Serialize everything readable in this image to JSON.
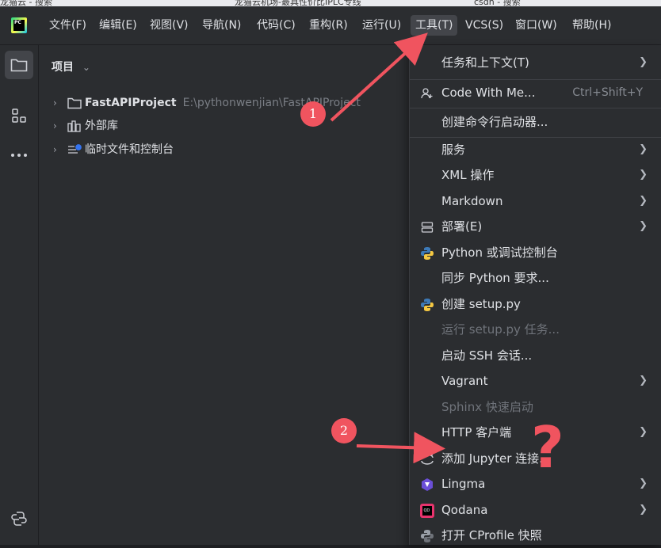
{
  "browser_tabs": [
    "龙猫云 - 搜索",
    "龙猫云机场-最具性价比IPLC专线",
    "csdn - 搜索"
  ],
  "menubar": {
    "items": [
      {
        "label": "文件(F)"
      },
      {
        "label": "编辑(E)"
      },
      {
        "label": "视图(V)"
      },
      {
        "label": "导航(N)"
      },
      {
        "label": "代码(C)"
      },
      {
        "label": "重构(R)"
      },
      {
        "label": "运行(U)"
      },
      {
        "label": "工具(T)",
        "active": true
      },
      {
        "label": "VCS(S)"
      },
      {
        "label": "窗口(W)"
      },
      {
        "label": "帮助(H)"
      }
    ]
  },
  "panel": {
    "title": "项目",
    "tree": [
      {
        "label": "FastAPIProject",
        "path": "E:\\pythonwenjian\\FastAPIProject",
        "icon": "folder-icon"
      },
      {
        "label": "外部库",
        "icon": "library-icon"
      },
      {
        "label": "临时文件和控制台",
        "icon": "scratches-icon"
      }
    ]
  },
  "tools_menu": {
    "items": [
      {
        "label": "任务和上下文(T)",
        "submenu": true
      },
      {
        "label": "Code With Me...",
        "shortcut": "Ctrl+Shift+Y",
        "icon": "person-add-icon"
      },
      {
        "label": "创建命令行启动器..."
      },
      {
        "label": "服务",
        "submenu": true
      },
      {
        "label": "XML 操作",
        "submenu": true
      },
      {
        "label": "Markdown",
        "submenu": true
      },
      {
        "label": "部署(E)",
        "submenu": true,
        "icon": "server-icon"
      },
      {
        "label": "Python 或调试控制台",
        "icon": "python-icon"
      },
      {
        "label": "同步 Python 要求..."
      },
      {
        "label": "创建 setup.py",
        "icon": "python-icon"
      },
      {
        "label": "运行 setup.py 任务...",
        "disabled": true
      },
      {
        "label": "启动 SSH 会话..."
      },
      {
        "label": "Vagrant",
        "submenu": true
      },
      {
        "label": "Sphinx 快速启动",
        "disabled": true
      },
      {
        "label": "HTTP 客户端",
        "submenu": true
      },
      {
        "label": "添加 Jupyter 连接...",
        "icon": "jupyter-icon"
      },
      {
        "label": "Lingma",
        "submenu": true,
        "icon": "lingma-icon"
      },
      {
        "label": "Qodana",
        "submenu": true,
        "icon": "qodana-icon"
      },
      {
        "label": "打开 CProfile 快照",
        "icon": "profiler-icon"
      }
    ]
  },
  "annotations": {
    "badge_1": "1",
    "badge_2": "2",
    "question_mark": "?",
    "color": "#f0545f"
  }
}
